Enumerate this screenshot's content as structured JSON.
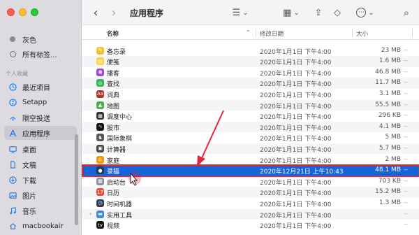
{
  "sidebar": {
    "tags": [
      {
        "label": "灰色",
        "icon": "grey-dot-icon"
      },
      {
        "label": "所有标签...",
        "icon": "tag-circle-icon"
      }
    ],
    "section_favorites": "个人收藏",
    "items": [
      {
        "label": "最近项目",
        "icon": "clock-icon"
      },
      {
        "label": "Setapp",
        "icon": "setapp-icon"
      },
      {
        "label": "隔空投送",
        "icon": "airdrop-icon"
      },
      {
        "label": "应用程序",
        "icon": "apps-icon"
      },
      {
        "label": "桌面",
        "icon": "desktop-icon"
      },
      {
        "label": "文稿",
        "icon": "document-icon"
      },
      {
        "label": "下载",
        "icon": "download-icon"
      },
      {
        "label": "图片",
        "icon": "picture-icon"
      },
      {
        "label": "音乐",
        "icon": "music-icon"
      },
      {
        "label": "macbookair",
        "icon": "home-icon"
      }
    ]
  },
  "toolbar": {
    "title": "应用程序",
    "back": "‹",
    "forward": "›",
    "list_view": "☰",
    "grid_view": "▦",
    "chevron": "⌄",
    "share": "⇪",
    "tag": "◇",
    "more": "⋯",
    "search": "⌕"
  },
  "columns": {
    "name": "名称",
    "date": "修改日期",
    "size": "大小"
  },
  "files": [
    {
      "name": "备忘录",
      "date": "2020年1月1日 下午4:00",
      "size": "23 MB",
      "color": "#f2c230",
      "glyph": "✎"
    },
    {
      "name": "便笺",
      "date": "2020年1月1日 下午4:00",
      "size": "1.6 MB",
      "color": "#f5d349",
      "glyph": "▤"
    },
    {
      "name": "播客",
      "date": "2020年1月1日 下午4:00",
      "size": "46.8 MB",
      "color": "#9b4ad8",
      "glyph": "◉"
    },
    {
      "name": "查找",
      "date": "2020年1月1日 下午4:00",
      "size": "11.7 MB",
      "color": "#34b45a",
      "glyph": "◎"
    },
    {
      "name": "词典",
      "date": "2020年1月1日 下午4:00",
      "size": "3.1 MB",
      "color": "#b0302c",
      "glyph": "Aa"
    },
    {
      "name": "地图",
      "date": "2020年1月1日 下午4:00",
      "size": "55.5 MB",
      "color": "#4caf50",
      "glyph": "▲"
    },
    {
      "name": "调度中心",
      "date": "2020年1月1日 下午4:00",
      "size": "296 KB",
      "color": "#333333",
      "glyph": "▦"
    },
    {
      "name": "股市",
      "date": "2020年1月1日 下午4:00",
      "size": "4.1 MB",
      "color": "#111111",
      "glyph": "∿"
    },
    {
      "name": "国际象棋",
      "date": "2020年1月1日 下午4:00",
      "size": "5 MB",
      "color": "#555555",
      "glyph": "♞"
    },
    {
      "name": "计算器",
      "date": "2020年1月1日 下午4:00",
      "size": "5.7 MB",
      "color": "#444444",
      "glyph": "▣"
    },
    {
      "name": "家庭",
      "date": "2020年1月1日 下午4:00",
      "size": "2 MB",
      "color": "#f39c12",
      "glyph": "⌂"
    },
    {
      "name": "录猫",
      "date": "2020年12月21日 上午10:43",
      "size": "48.1 MB",
      "color": "#1a3a5a",
      "glyph": "●"
    },
    {
      "name": "启动台",
      "date": "2020年1月1日 下午4:00",
      "size": "703 KB",
      "color": "#8e8e93",
      "glyph": "▦"
    },
    {
      "name": "日历",
      "date": "2020年1月1日 下午4:00",
      "size": "15.2 MB",
      "color": "#e74c3c",
      "glyph": "17"
    },
    {
      "name": "时间机器",
      "date": "2020年1月1日 下午4:00",
      "size": "1.3 MB",
      "color": "#2c3e50",
      "glyph": "◷"
    },
    {
      "name": "实用工具",
      "date": "2020年1月1日 下午4:00",
      "size": "",
      "color": "#3b8bd9",
      "glyph": "▬"
    },
    {
      "name": "视频",
      "date": "2020年1月1日 下午4:00",
      "size": "",
      "color": "#111111",
      "glyph": "tv"
    }
  ],
  "selected_index": 11,
  "expandable_index": 15,
  "size_dash": "--"
}
